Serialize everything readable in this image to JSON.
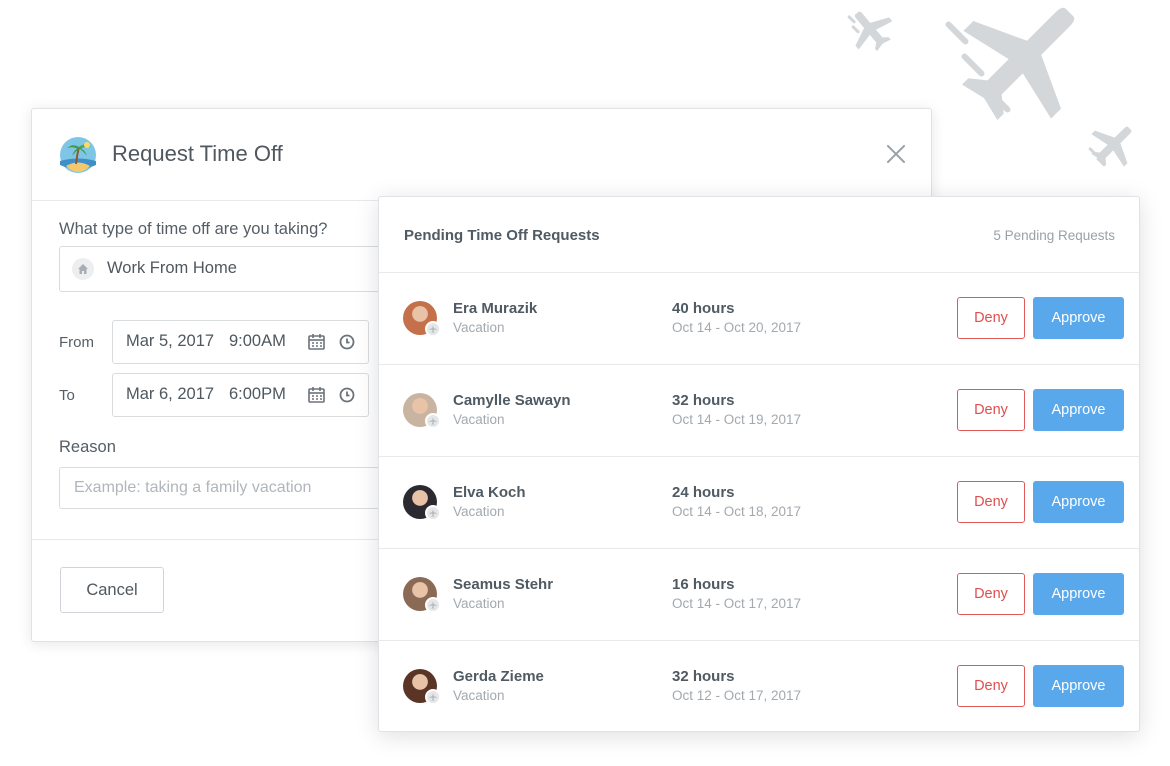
{
  "decorations": {
    "plane_icon": "plane-icon",
    "plane_color": "#d4d7da"
  },
  "dialog": {
    "title": "Request Time Off",
    "icon": "beach-palm-icon",
    "question": "What type of time off are you taking?",
    "type_select": {
      "value": "Work From Home",
      "icon": "home-icon"
    },
    "from": {
      "label": "From",
      "date": "Mar 5, 2017",
      "time": "9:00AM"
    },
    "to": {
      "label": "To",
      "date": "Mar 6, 2017",
      "time": "6:00PM"
    },
    "reason": {
      "label": "Reason",
      "placeholder": "Example: taking a family vacation"
    },
    "cancel_label": "Cancel"
  },
  "pending": {
    "title": "Pending Time Off Requests",
    "count_label": "5 Pending Requests",
    "deny_label": "Deny",
    "approve_label": "Approve",
    "colors": {
      "deny": "#de4f4f",
      "approve": "#5aa8ec"
    },
    "requests": [
      {
        "name": "Era Murazik",
        "type": "Vacation",
        "hours": "40 hours",
        "dates": "Oct 14 - Oct 20, 2017",
        "avatar_color": "#c4704a"
      },
      {
        "name": "Camylle Sawayn",
        "type": "Vacation",
        "hours": "32 hours",
        "dates": "Oct 14 - Oct 19, 2017",
        "avatar_color": "#c9b4a2"
      },
      {
        "name": "Elva Koch",
        "type": "Vacation",
        "hours": "24 hours",
        "dates": "Oct 14 - Oct 18, 2017",
        "avatar_color": "#2c2a30"
      },
      {
        "name": "Seamus Stehr",
        "type": "Vacation",
        "hours": "16 hours",
        "dates": "Oct 14 - Oct 17, 2017",
        "avatar_color": "#8a6a55"
      },
      {
        "name": "Gerda Zieme",
        "type": "Vacation",
        "hours": "32 hours",
        "dates": "Oct 12 - Oct 17, 2017",
        "avatar_color": "#5a3526"
      }
    ]
  }
}
